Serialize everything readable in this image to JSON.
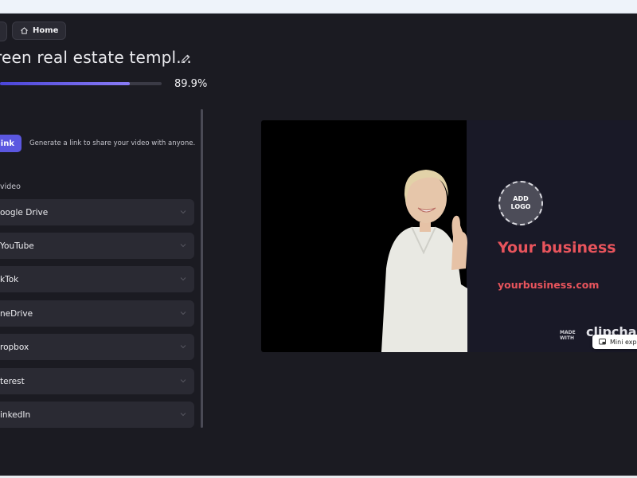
{
  "nav": {
    "home_label": "Home"
  },
  "project": {
    "title": "reen real estate templ..."
  },
  "export": {
    "progress_fraction": 0.803,
    "progress_text": "89.9%"
  },
  "share": {
    "link_button_label": "link",
    "link_description": "Generate a link to share your video with anyone.",
    "section_label": "video",
    "destinations": [
      {
        "label": "oogle Drive"
      },
      {
        "label": "YouTube"
      },
      {
        "label": "kTok"
      },
      {
        "label": "neDrive"
      },
      {
        "label": "ropbox"
      },
      {
        "label": "terest"
      },
      {
        "label": "inkedIn"
      }
    ]
  },
  "preview": {
    "logo_placeholder_line1": "ADD",
    "logo_placeholder_line2": "LOGO",
    "business_name": "Your business",
    "business_url": "yourbusiness.com",
    "watermark_line1": "MADE",
    "watermark_line2": "WITH",
    "watermark_brand": "clipcha",
    "mini_label": "Mini expo"
  },
  "colors": {
    "accent": "#5b57e0",
    "brand_red": "#e8545c",
    "background": "#1b1b22"
  },
  "icons": [
    "home-icon",
    "pencil-icon",
    "chevron-down-icon",
    "mini-player-icon"
  ]
}
